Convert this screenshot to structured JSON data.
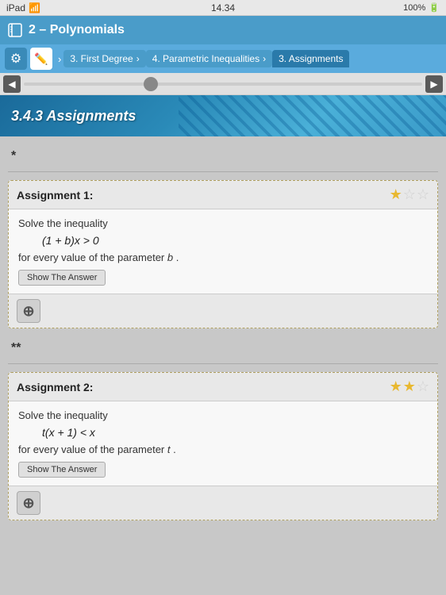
{
  "statusBar": {
    "left": "iPad",
    "wifi": "wifi",
    "time": "14.34",
    "battery": "100%",
    "batteryIcon": "🔋"
  },
  "titleBar": {
    "title": "2 – Polynomials"
  },
  "navBar": {
    "breadcrumbs": [
      {
        "id": "bc1",
        "label": "3. First Degree",
        "hasArrow": true
      },
      {
        "id": "bc2",
        "label": "4. Parametric Inequalities",
        "hasArrow": true
      },
      {
        "id": "bc3",
        "label": "3. Assignments",
        "hasArrow": false,
        "active": true
      }
    ]
  },
  "sectionHeader": {
    "title": "3.4.3 Assignments"
  },
  "assignments": [
    {
      "id": "a1",
      "difficulty": "*",
      "title": "Assignment 1:",
      "stars": 1,
      "maxStars": 3,
      "instruction": "Solve the inequality",
      "equation": "(1 + b)x > 0",
      "parameter": "for every value of the parameter b .",
      "showAnswerLabel": "Show The Answer"
    },
    {
      "id": "a2",
      "difficulty": "**",
      "title": "Assignment 2:",
      "stars": 2,
      "maxStars": 3,
      "instruction": "Solve the inequality",
      "equation": "t(x + 1) < x",
      "parameter": "for every value of the parameter t .",
      "showAnswerLabel": "Show The Answer"
    }
  ],
  "addButtonLabel": "+"
}
